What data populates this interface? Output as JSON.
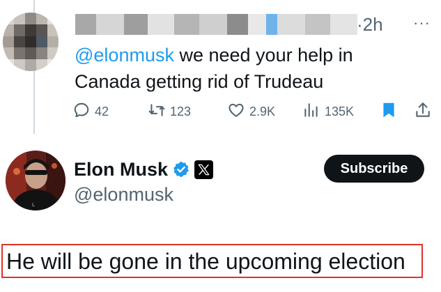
{
  "reply_tweet": {
    "time": "·2h",
    "mention": "@elonmusk",
    "text_rest": " we need your help in Canada getting rid of Trudeau",
    "actions": {
      "replies": "42",
      "reposts": "123",
      "likes": "2.9K",
      "views": "135K"
    },
    "icons": [
      "more-icon",
      "reply-icon",
      "repost-icon",
      "like-icon",
      "views-icon",
      "bookmark-icon",
      "share-icon"
    ]
  },
  "main_tweet": {
    "name": "Elon Musk",
    "handle": "@elonmusk",
    "subscribe_label": "Subscribe",
    "text": "He will be gone in the upcoming election",
    "icons": [
      "verified-icon",
      "x-affiliation-icon"
    ]
  },
  "colors": {
    "accent": "#1d9bf0",
    "text_primary": "#0f1419",
    "text_secondary": "#536471",
    "highlight_border": "#e0312c"
  }
}
